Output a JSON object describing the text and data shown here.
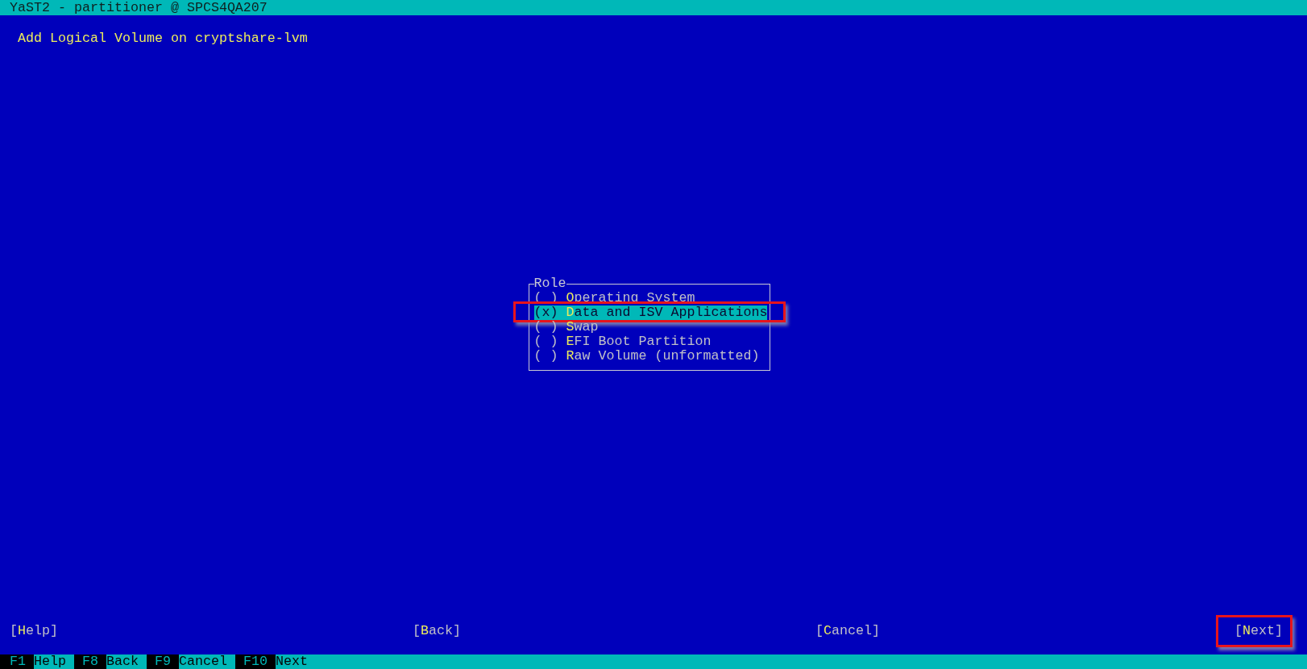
{
  "window": {
    "title": "YaST2 - partitioner @ SPCS4QA207"
  },
  "dialog": {
    "heading": "Add Logical Volume on cryptshare-lvm"
  },
  "role": {
    "label": "Role",
    "options": [
      {
        "radio": "( )",
        "label": "**O**perating System",
        "selected": false,
        "callout": false
      },
      {
        "radio": "(x)",
        "label": "**D**ata and ISV Applications",
        "selected": true,
        "callout": true
      },
      {
        "radio": "( )",
        "label": "**S**wap",
        "selected": false,
        "callout": false
      },
      {
        "radio": "( )",
        "label": "**E**FI Boot Partition",
        "selected": false,
        "callout": false
      },
      {
        "radio": "( )",
        "label": "**R**aw Volume (unformatted)",
        "selected": false,
        "callout": false
      }
    ]
  },
  "buttons": [
    {
      "label": "[**H**elp]",
      "callout": false
    },
    {
      "label": "[**B**ack]",
      "callout": false
    },
    {
      "label": "[**C**ancel]",
      "callout": false
    },
    {
      "label": "[**N**ext]",
      "callout": true
    }
  ],
  "function_keys": [
    {
      "key": "F1",
      "label": "Help"
    },
    {
      "key": "F8",
      "label": "Back"
    },
    {
      "key": "F9",
      "label": "Cancel"
    },
    {
      "key": "F10",
      "label": "Next"
    }
  ]
}
